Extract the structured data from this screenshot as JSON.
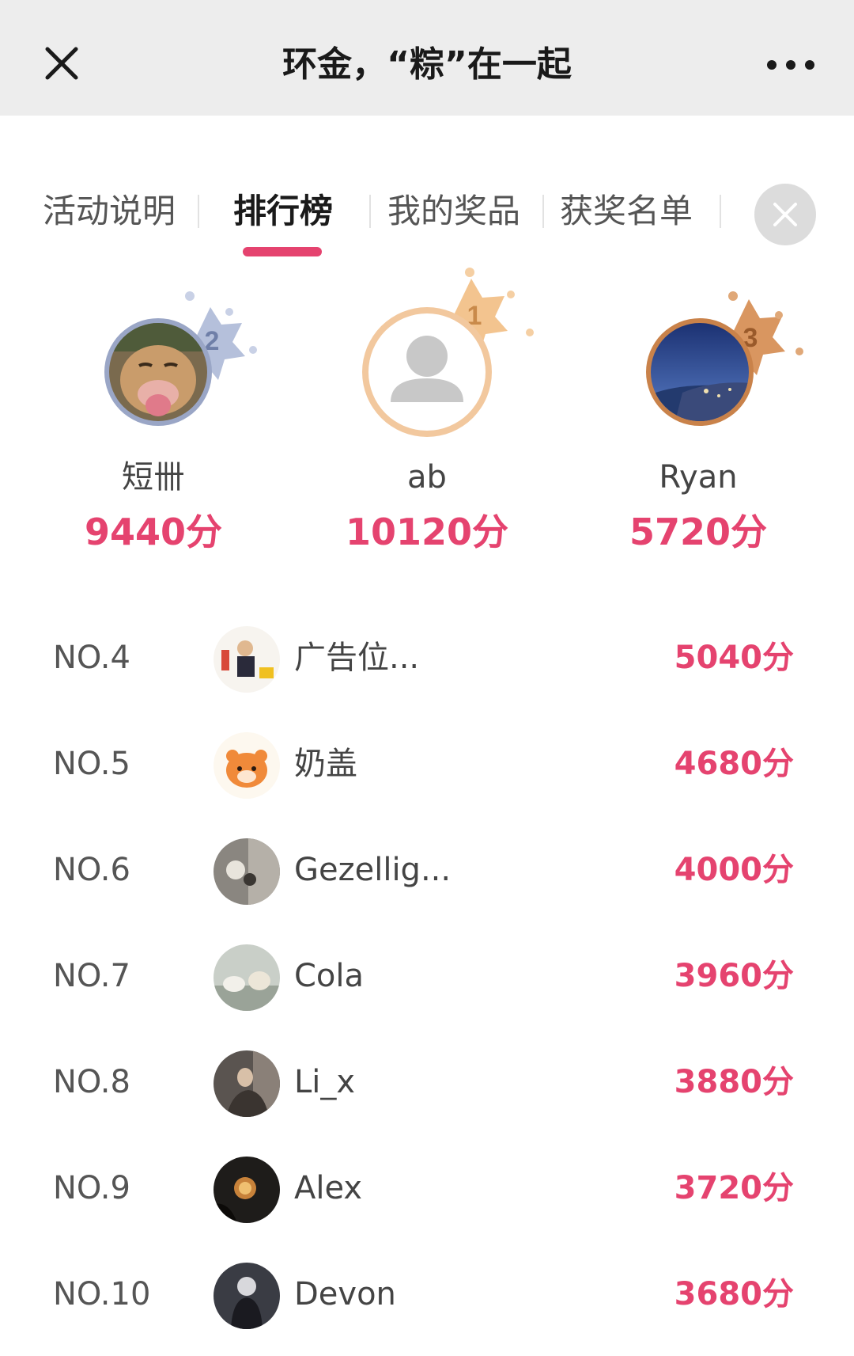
{
  "header": {
    "title": "环金，“粽”在一起",
    "close_icon": "close-icon",
    "more_icon": "more-dots-icon"
  },
  "tabs": [
    {
      "label": "活动说明",
      "active": false
    },
    {
      "label": "排行榜",
      "active": true
    },
    {
      "label": "我的奖品",
      "active": false
    },
    {
      "label": "获奖名单",
      "active": false
    }
  ],
  "accent_color": "#e5436f",
  "podium": [
    {
      "place": "2",
      "name": "短卌",
      "score": "9440分",
      "badge_color": "#8e9ec4"
    },
    {
      "place": "1",
      "name": "ab",
      "score": "10120分",
      "badge_color": "#f0b778"
    },
    {
      "place": "3",
      "name": "Ryan",
      "score": "5720分",
      "badge_color": "#d68a4a"
    }
  ],
  "ranking": [
    {
      "rank": "NO.4",
      "name": "广告位...",
      "score": "5040分"
    },
    {
      "rank": "NO.5",
      "name": "奶盖",
      "score": "4680分"
    },
    {
      "rank": "NO.6",
      "name": "Gezellig...",
      "score": "4000分"
    },
    {
      "rank": "NO.7",
      "name": "Cola",
      "score": "3960分"
    },
    {
      "rank": "NO.8",
      "name": "Li_x",
      "score": "3880分"
    },
    {
      "rank": "NO.9",
      "name": "Alex",
      "score": "3720分"
    },
    {
      "rank": "NO.10",
      "name": "Devon",
      "score": "3680分"
    }
  ]
}
